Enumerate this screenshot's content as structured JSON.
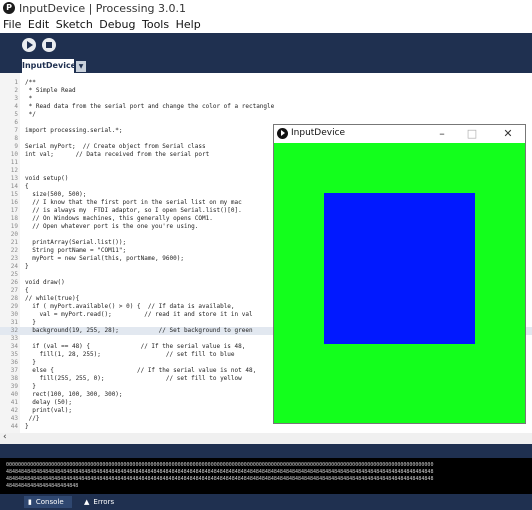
{
  "window": {
    "title": "InputDevice | Processing 3.0.1"
  },
  "menu": [
    "File",
    "Edit",
    "Sketch",
    "Debug",
    "Tools",
    "Help"
  ],
  "tabs": {
    "active": "InputDevice"
  },
  "code_lines": [
    {
      "n": "1",
      "text": "/**"
    },
    {
      "n": "2",
      "text": " * Simple Read"
    },
    {
      "n": "3",
      "text": " *"
    },
    {
      "n": "4",
      "text": " * Read data from the serial port and change the color of a rectangle"
    },
    {
      "n": "5",
      "text": " */"
    },
    {
      "n": "6",
      "text": ""
    },
    {
      "n": "7",
      "text": "import processing.serial.*;"
    },
    {
      "n": "8",
      "text": ""
    },
    {
      "n": "9",
      "text": "Serial myPort;  // Create object from Serial class"
    },
    {
      "n": "10",
      "text": "int val;      // Data received from the serial port"
    },
    {
      "n": "11",
      "text": ""
    },
    {
      "n": "12",
      "text": ""
    },
    {
      "n": "13",
      "text": "void setup()"
    },
    {
      "n": "14",
      "text": "{"
    },
    {
      "n": "15",
      "text": "  size(500, 500);"
    },
    {
      "n": "16",
      "text": "  // I know that the first port in the serial list on my mac"
    },
    {
      "n": "17",
      "text": "  // is always my  FTDI adaptor, so I open Serial.list()[0]."
    },
    {
      "n": "18",
      "text": "  // On Windows machines, this generally opens COM1."
    },
    {
      "n": "19",
      "text": "  // Open whatever port is the one you're using."
    },
    {
      "n": "20",
      "text": ""
    },
    {
      "n": "21",
      "text": "  printArray(Serial.list());"
    },
    {
      "n": "22",
      "text": "  String portName = \"COM11\";"
    },
    {
      "n": "23",
      "text": "  myPort = new Serial(this, portName, 9600);"
    },
    {
      "n": "24",
      "text": "}"
    },
    {
      "n": "25",
      "text": ""
    },
    {
      "n": "26",
      "text": "void draw()"
    },
    {
      "n": "27",
      "text": "{"
    },
    {
      "n": "28",
      "text": "// while(true){"
    },
    {
      "n": "29",
      "text": "  if ( myPort.available() > 0) {  // If data is available,"
    },
    {
      "n": "30",
      "text": "    val = myPort.read();         // read it and store it in val"
    },
    {
      "n": "31",
      "text": "  }"
    },
    {
      "n": "32",
      "text": "  background(19, 255, 28);           // Set background to green"
    },
    {
      "n": "33",
      "text": ""
    },
    {
      "n": "34",
      "text": "  if (val == 48) {              // If the serial value is 48,"
    },
    {
      "n": "35",
      "text": "    fill(1, 28, 255);                  // set fill to blue"
    },
    {
      "n": "36",
      "text": "  }"
    },
    {
      "n": "37",
      "text": "  else {                       // If the serial value is not 48,"
    },
    {
      "n": "38",
      "text": "    fill(255, 255, 0);                 // set fill to yellow"
    },
    {
      "n": "39",
      "text": "  }"
    },
    {
      "n": "40",
      "text": "  rect(100, 100, 300, 300);"
    },
    {
      "n": "41",
      "text": "  delay (50);"
    },
    {
      "n": "42",
      "text": "  print(val);"
    },
    {
      "n": "43",
      "text": " //}"
    },
    {
      "n": "44",
      "text": "}"
    }
  ],
  "highlight_line": "32",
  "console_lines": [
    "0000000000000000000000000000000000000000000000000000000000000000000000000000000000000000000000000000000000000000000000000000000000000000000000",
    "4848484848484848484848484848484848484848484848484848484848484848484848484848484848484848484848484848484848484848484848484848484848484848484848",
    "4848484848484848484848484848484848484848484848484848484848484848484848484848484848484848484848484848484848484848484848484848484848484848484848",
    "484848484848484848484848"
  ],
  "bottom_tabs": {
    "console": "Console",
    "errors": "Errors"
  },
  "sketch_window": {
    "title": "InputDevice",
    "background": "#13ff1c",
    "fill": "#0119ff"
  }
}
